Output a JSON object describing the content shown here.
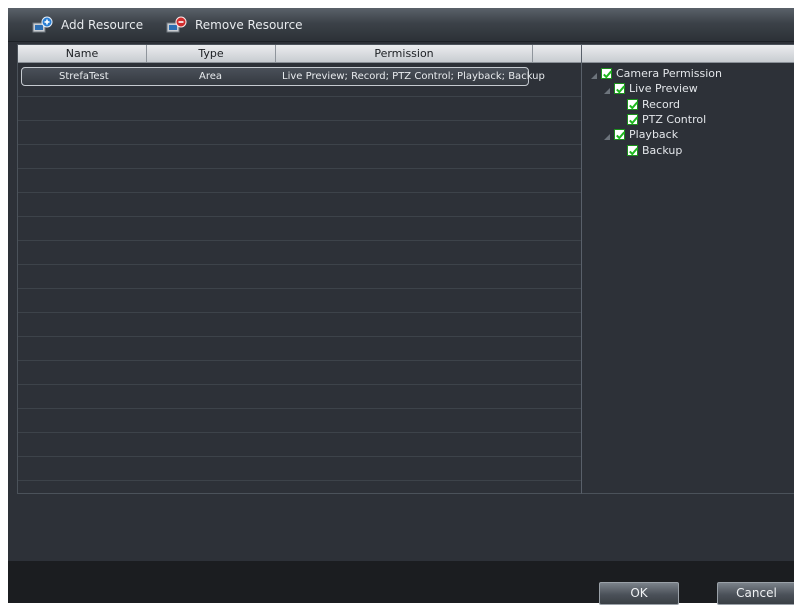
{
  "toolbar": {
    "add_label": "Add Resource",
    "remove_label": "Remove Resource"
  },
  "table": {
    "columns": [
      "Name",
      "Type",
      "Permission",
      ""
    ],
    "rows": [
      {
        "name": "StrefaTest",
        "type": "Area",
        "permission": "Live Preview; Record; PTZ Control; Playback; Backup"
      }
    ]
  },
  "tree": {
    "root": {
      "label": "Camera Permission",
      "checked": true
    },
    "live_preview": {
      "label": "Live Preview",
      "checked": true
    },
    "record": {
      "label": "Record",
      "checked": true
    },
    "ptz": {
      "label": "PTZ Control",
      "checked": true
    },
    "playback": {
      "label": "Playback",
      "checked": true
    },
    "backup": {
      "label": "Backup",
      "checked": true
    }
  },
  "footer": {
    "ok_label": "OK",
    "cancel_label": "Cancel"
  },
  "colors": {
    "background": "#2d3138",
    "check": "#1fb81f",
    "header": "#d8dbdf"
  }
}
